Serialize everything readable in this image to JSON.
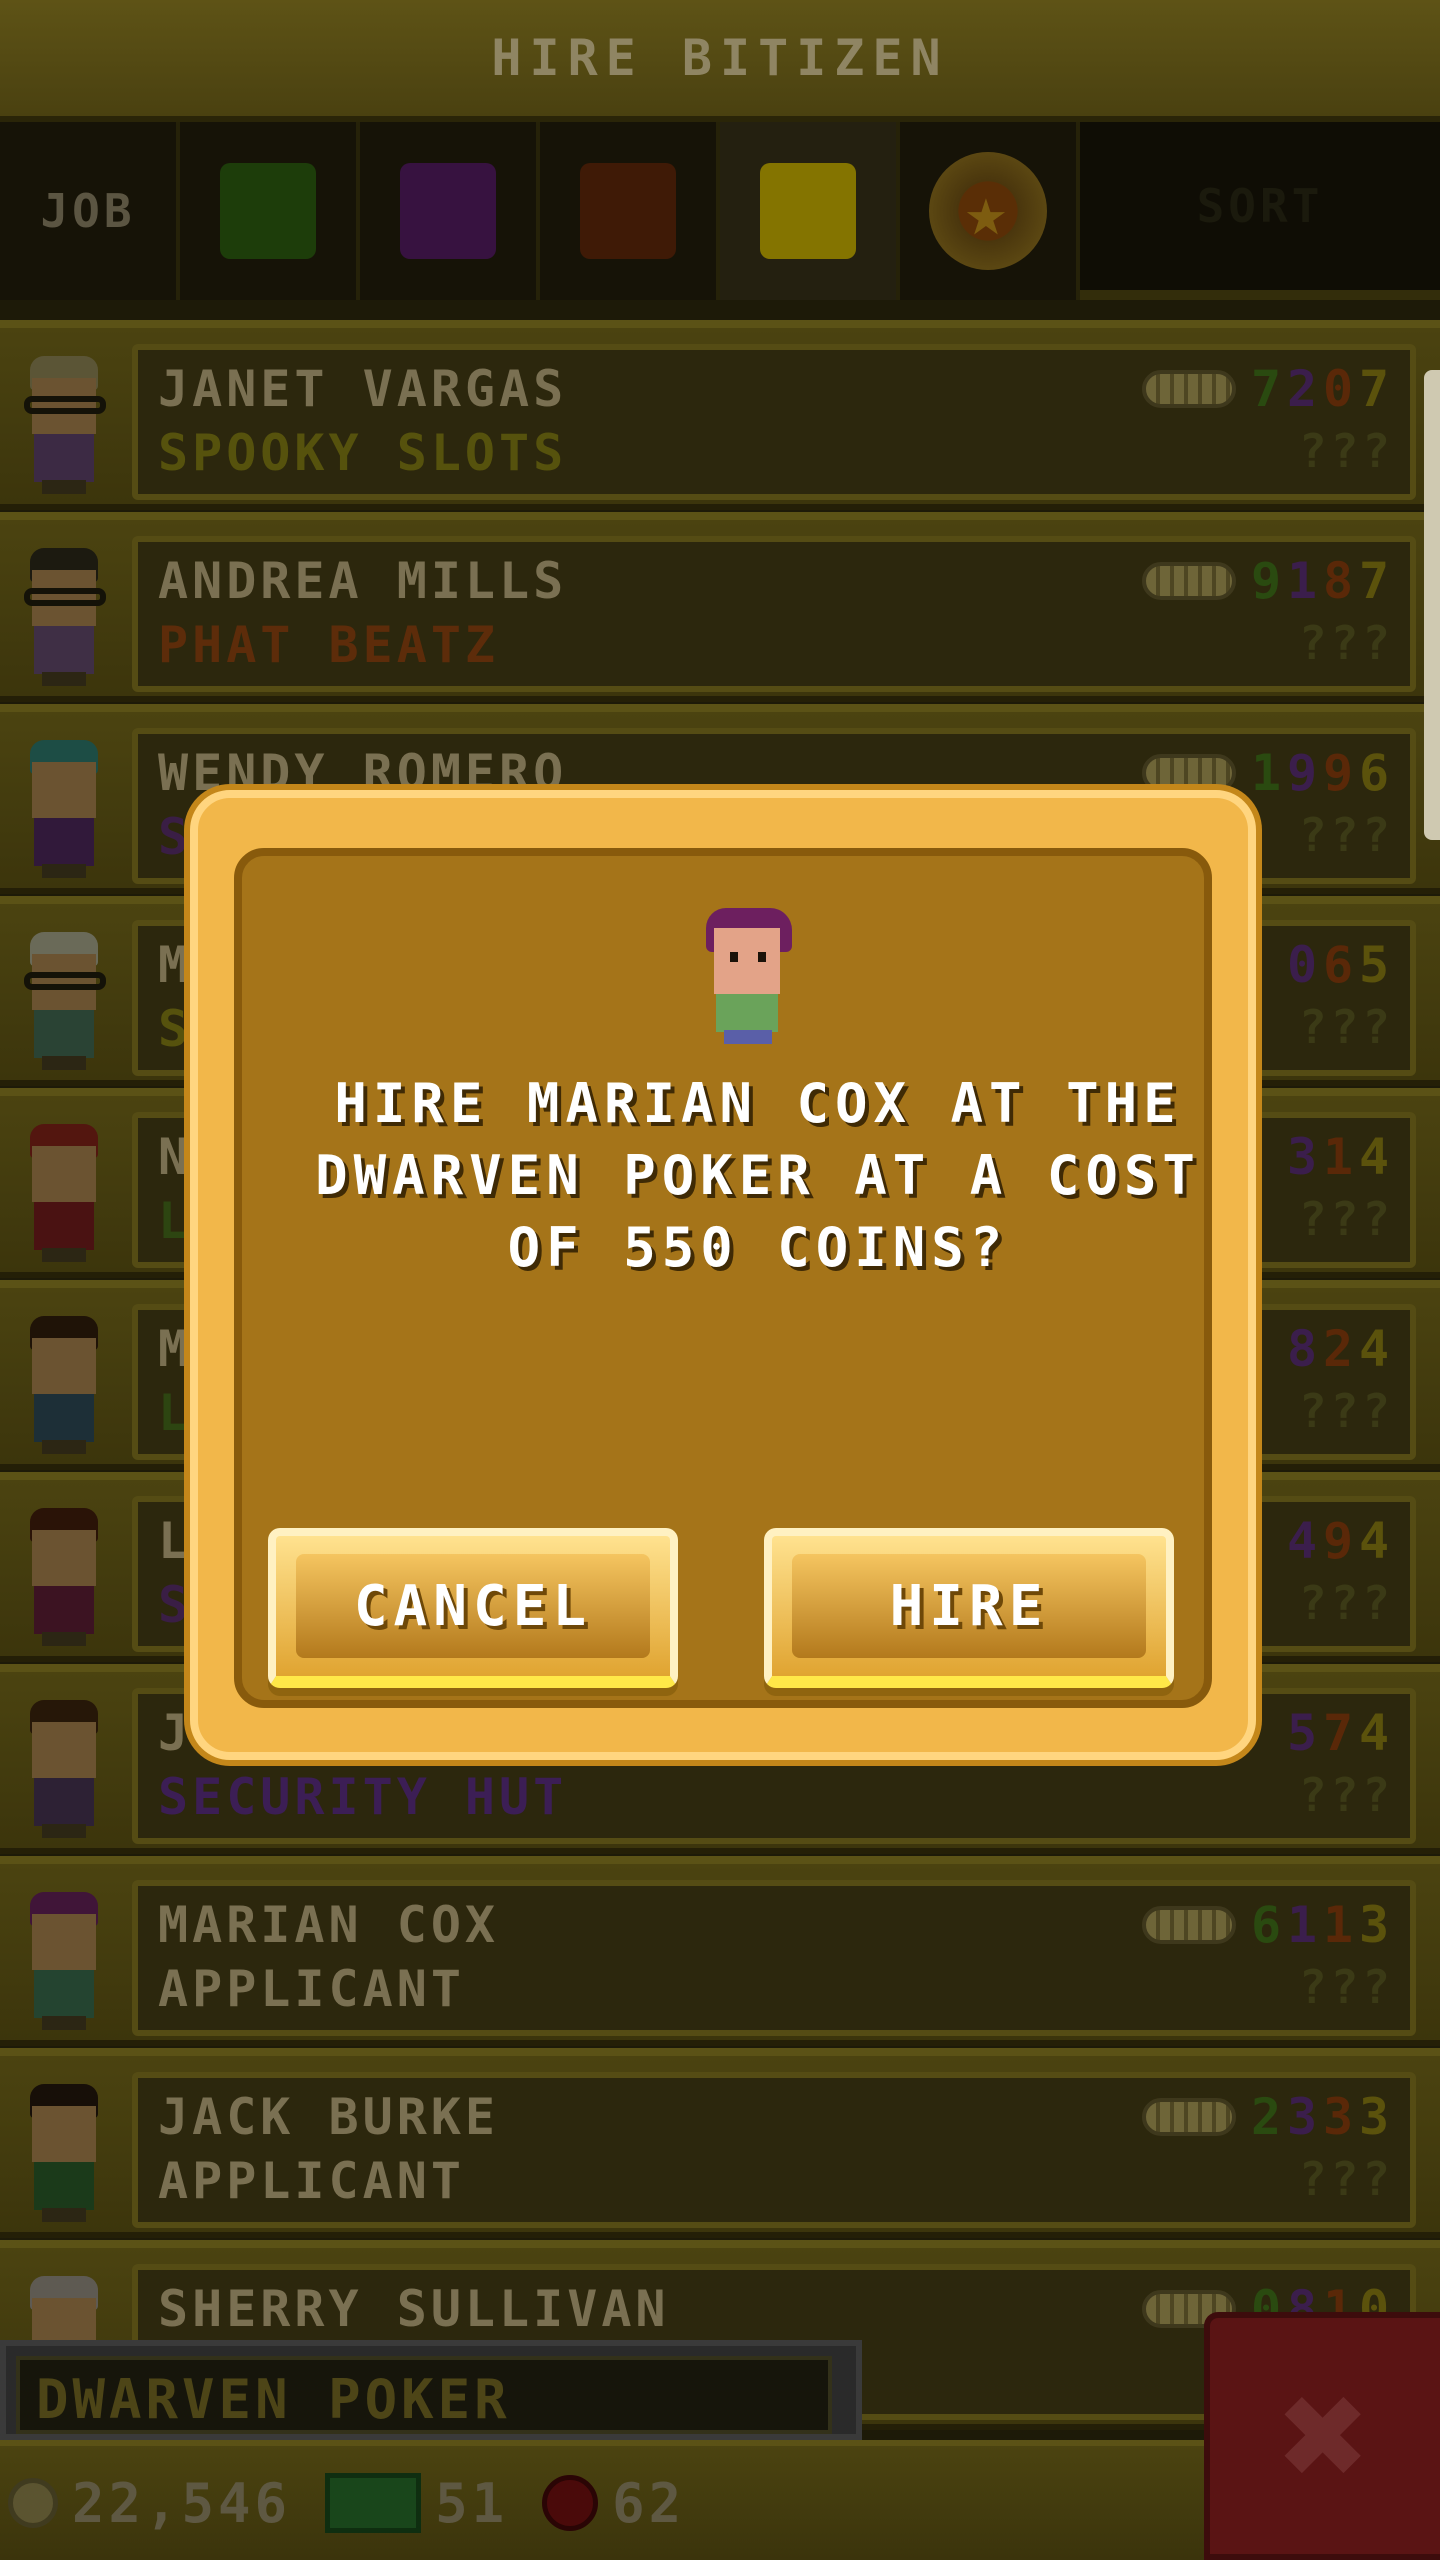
{
  "header": {
    "title": "HIRE BITIZEN"
  },
  "filters": {
    "job_label": "JOB",
    "categories": [
      {
        "name": "food",
        "color": "#1d3d0a"
      },
      {
        "name": "service",
        "color": "#371240"
      },
      {
        "name": "recreation",
        "color": "#3f1a06"
      },
      {
        "name": "retail",
        "color": "#847400",
        "active": true
      },
      {
        "name": "dream-job",
        "icon": "star-icon"
      }
    ],
    "sort_label": "SORT"
  },
  "rows": [
    {
      "name": "JANET VARGAS",
      "job": "SPOOKY SLOTS",
      "job_color": "#56520d",
      "skills": [
        "7",
        "2",
        "0",
        "7"
      ],
      "unknown": "???",
      "hair": "#5b5536",
      "glasses": true,
      "shirt": "#3c2a44"
    },
    {
      "name": "ANDREA MILLS",
      "job": "PHAT BEATZ",
      "job_color": "#5d2c0a",
      "skills": [
        "9",
        "1",
        "8",
        "7"
      ],
      "unknown": "???",
      "hair": "#1c1a10",
      "glasses": true,
      "shirt": "#3f2f45"
    },
    {
      "name": "WENDY ROMERO",
      "job": "SP",
      "job_color": "#3a1e45",
      "skills": [
        "1",
        "9",
        "9",
        "6"
      ],
      "unknown": "???",
      "hair": "#1d4d45",
      "glasses": false,
      "shirt": "#31193a"
    },
    {
      "name": "M",
      "job": "S",
      "job_color": "#56520d",
      "skills": [
        "",
        "0",
        "6",
        "5"
      ],
      "unknown": "???",
      "hair": "#6a6a58",
      "glasses": true,
      "shirt": "#2a4334"
    },
    {
      "name": "N",
      "job": "L",
      "job_color": "#2d4511",
      "skills": [
        "",
        "3",
        "1",
        "4"
      ],
      "unknown": "???",
      "hair": "#53160f",
      "glasses": false,
      "shirt": "#4a1212"
    },
    {
      "name": "M",
      "job": "L",
      "job_color": "#2d4511",
      "skills": [
        "",
        "8",
        "2",
        "4"
      ],
      "unknown": "???",
      "hair": "#1f1307",
      "glasses": false,
      "shirt": "#1d2f37"
    },
    {
      "name": "L",
      "job": "S",
      "job_color": "#3a1e45",
      "skills": [
        "",
        "4",
        "9",
        "4"
      ],
      "unknown": "???",
      "hair": "#2a1307",
      "glasses": false,
      "shirt": "#3c1322"
    },
    {
      "name": "J",
      "job": "SECURITY HUT",
      "job_color": "#3c1e55",
      "skills": [
        "",
        "5",
        "7",
        "4"
      ],
      "unknown": "???",
      "hair": "#261708",
      "glasses": false,
      "shirt": "#2d2134"
    },
    {
      "name": "MARIAN COX",
      "job": "APPLICANT",
      "job_color": "#7a7052",
      "skills": [
        "6",
        "1",
        "1",
        "3"
      ],
      "unknown": "???",
      "hair": "#401538",
      "glasses": false,
      "shirt": "#244430"
    },
    {
      "name": "JACK BURKE",
      "job": "APPLICANT",
      "job_color": "#7a7052",
      "skills": [
        "2",
        "3",
        "3",
        "3"
      ],
      "unknown": "???",
      "hair": "#170f08",
      "glasses": false,
      "shirt": "#1b3a1a"
    },
    {
      "name": "SHERRY SULLIVAN",
      "job": "",
      "job_color": "#7a7052",
      "skills": [
        "0",
        "8",
        "1",
        "0"
      ],
      "unknown": "",
      "hair": "#5e5a52",
      "glasses": false,
      "shirt": "#3a3a3a"
    }
  ],
  "floor": {
    "label": "DWARVEN POKER"
  },
  "stats": {
    "coins": "22,546",
    "bux": "51",
    "gems": "62"
  },
  "dialog": {
    "message": "HIRE MARIAN COX AT THE DWARVEN POKER AT A COST OF 550 COINS?",
    "cancel_label": "CANCEL",
    "hire_label": "HIRE"
  },
  "close_label": "✖",
  "skill_colors": [
    "#2a4a10",
    "#3b1e4c",
    "#5a2808",
    "#5b520c"
  ]
}
